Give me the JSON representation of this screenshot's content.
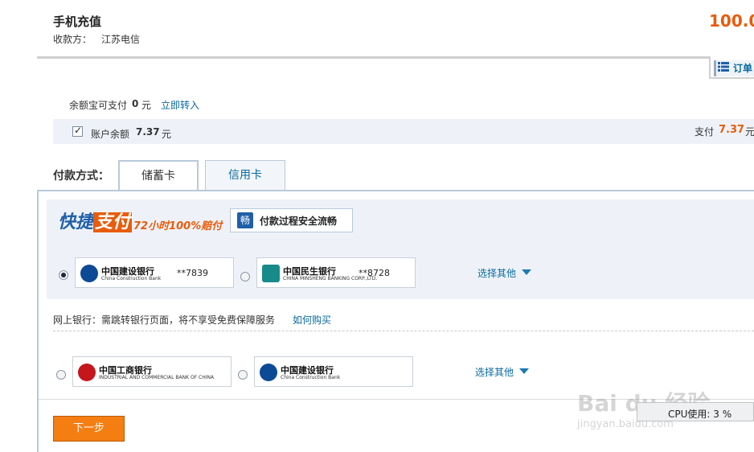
{
  "header": {
    "title": "手机充值",
    "payee_label": "收款方：",
    "payee_name": "江苏电信",
    "amount": "100.0",
    "order_tab_label": "订单"
  },
  "balance": {
    "yeb_label": "余额宝可支付",
    "yeb_value": "0",
    "yeb_unit": "元",
    "yeb_link": "立即转入",
    "account_label": "账户余额",
    "account_value": "7.37",
    "account_unit": "元",
    "account_checked": true,
    "pay_label": "支付",
    "pay_value": "7.37",
    "pay_unit": "元"
  },
  "payment": {
    "method_label": "付款方式：",
    "tabs": [
      {
        "label": "储蓄卡",
        "active": true
      },
      {
        "label": "信用卡",
        "active": false
      }
    ]
  },
  "quickpay": {
    "logo_a": "快捷",
    "logo_b": "支付",
    "slogan": "72小时100%赔付",
    "badge_icon": "畅",
    "badge_text": "付款过程安全流畅",
    "banks": [
      {
        "name": "中国建设银行",
        "en": "China Construction Bank",
        "tail": "**7839",
        "selected": true,
        "logo_color": "#0d4a96"
      },
      {
        "name": "中国民生银行",
        "en": "CHINA MINSHENG BANKING CORP.,LTD.",
        "tail": "**8728",
        "selected": false,
        "logo_color": "#178b8a"
      }
    ],
    "more_label": "选择其他"
  },
  "netbank": {
    "label": "网上银行：需跳转银行页面，将不享受免费保障服务",
    "link": "如何购买",
    "banks": [
      {
        "name": "中国工商银行",
        "en": "INDUSTRIAL AND COMMERCIAL BANK OF CHINA",
        "selected": false,
        "logo_color": "#c5161d"
      },
      {
        "name": "中国建设银行",
        "en": "China Construction Bank",
        "selected": false,
        "logo_color": "#0d4a96"
      }
    ],
    "more_label": "选择其他"
  },
  "actions": {
    "next_label": "下一步"
  },
  "overlay": {
    "watermark": "Bai du 经验",
    "watermark_url": "jingyan.baidu.com",
    "cpu_text": "CPU使用: 3 %"
  },
  "colors": {
    "accent": "#e85c0c",
    "link": "#0a6a9e",
    "panel_bg": "#eef2f8",
    "button": "#f57e12"
  }
}
